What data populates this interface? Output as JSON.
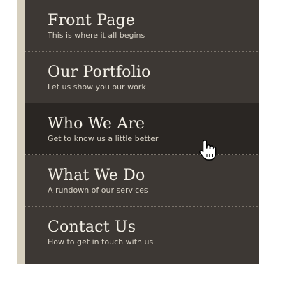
{
  "menu": {
    "active_index": 2,
    "items": [
      {
        "title": "Front Page",
        "subtitle": "This is where it all begins"
      },
      {
        "title": "Our Portfolio",
        "subtitle": "Let us show you our work"
      },
      {
        "title": "Who We Are",
        "subtitle": "Get to know us a little better"
      },
      {
        "title": "What We Do",
        "subtitle": "A rundown of our services"
      },
      {
        "title": "Contact Us",
        "subtitle": "How to get in touch with us"
      }
    ]
  },
  "colors": {
    "menu_bg": "#3d3834",
    "active_bg": "#2a2623",
    "rail": "#d6cfbe",
    "title_text": "#f3efe6",
    "subtitle_text": "#d8d2c6"
  },
  "cursor": {
    "icon": "hand-pointer-icon"
  }
}
